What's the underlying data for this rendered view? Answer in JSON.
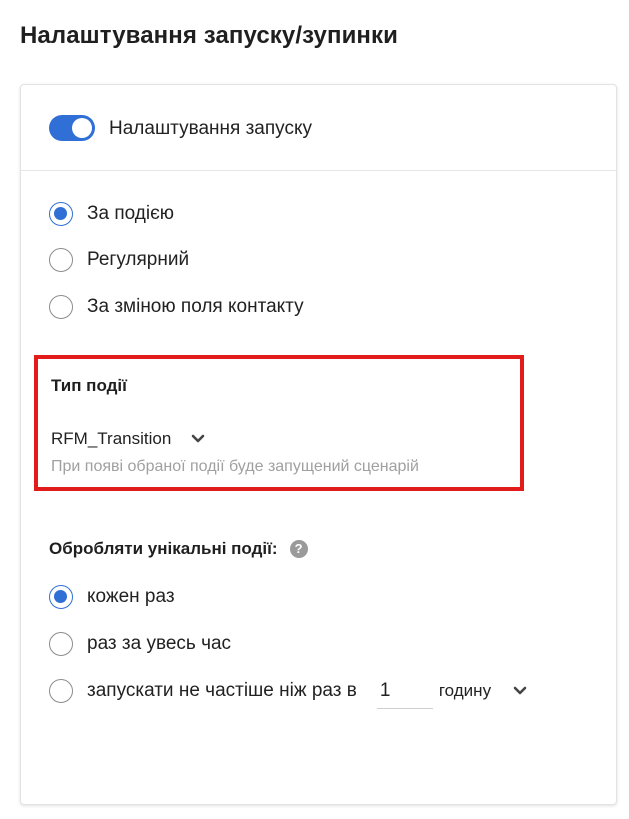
{
  "page": {
    "title": "Налаштування запуску/зупинки"
  },
  "launch": {
    "toggle_label": "Налаштування запуску",
    "toggle_on": true,
    "options": [
      {
        "label": "За подією",
        "checked": true
      },
      {
        "label": "Регулярний",
        "checked": false
      },
      {
        "label": "За зміною поля контакту",
        "checked": false
      }
    ]
  },
  "event": {
    "title": "Тип події",
    "selected": "RFM_Transition",
    "hint": "При появі обраної події буде запущений сценарій"
  },
  "unique": {
    "title": "Обробляти унікальні події:",
    "help_icon": "question-circle-icon",
    "options": [
      {
        "label": "кожен раз",
        "checked": true
      },
      {
        "label": "раз за увесь час",
        "checked": false
      },
      {
        "label": "запускати не частіше ніж раз в",
        "checked": false
      }
    ],
    "frequency_value": "1",
    "frequency_unit": "годину"
  },
  "colors": {
    "accent": "#2f6fd6",
    "highlight_border": "#e21b1b",
    "hint_text": "#a0a0a0"
  }
}
